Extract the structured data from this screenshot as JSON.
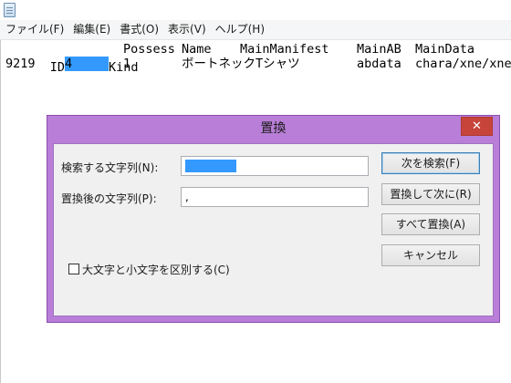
{
  "app": {
    "icon": "notepad-icon"
  },
  "menu": [
    "ファイル(F)",
    "編集(E)",
    "書式(O)",
    "表示(V)",
    "ヘルプ(H)"
  ],
  "document": {
    "header": {
      "c0a": "ID",
      "c0b": "Kind",
      "c1": "Possess",
      "c2": "Name",
      "c3": "MainManifest",
      "c4": "MainAB",
      "c5": "MainData"
    },
    "row1": {
      "c0a": "9219",
      "c0b": "4",
      "c1": "1",
      "c2": "ボートネックTシャツ",
      "c4": "abdata",
      "c5": "chara/xne/xne"
    }
  },
  "dialog": {
    "title": "置換",
    "close_icon": "close-icon",
    "find_label": "検索する文字列(N):",
    "find_value": "",
    "replace_label": "置換後の文字列(P):",
    "replace_value": ",",
    "buttons": {
      "find_next": "次を検索(F)",
      "replace": "置換して次に(R)",
      "replace_all": "すべて置換(A)",
      "cancel": "キャンセル"
    },
    "match_case_label": "大文字と小文字を区別する(C)",
    "match_case_checked": false
  },
  "colors": {
    "dialog_frame": "#b87ed8",
    "selection": "#3399ff",
    "close_button": "#c7443a"
  }
}
